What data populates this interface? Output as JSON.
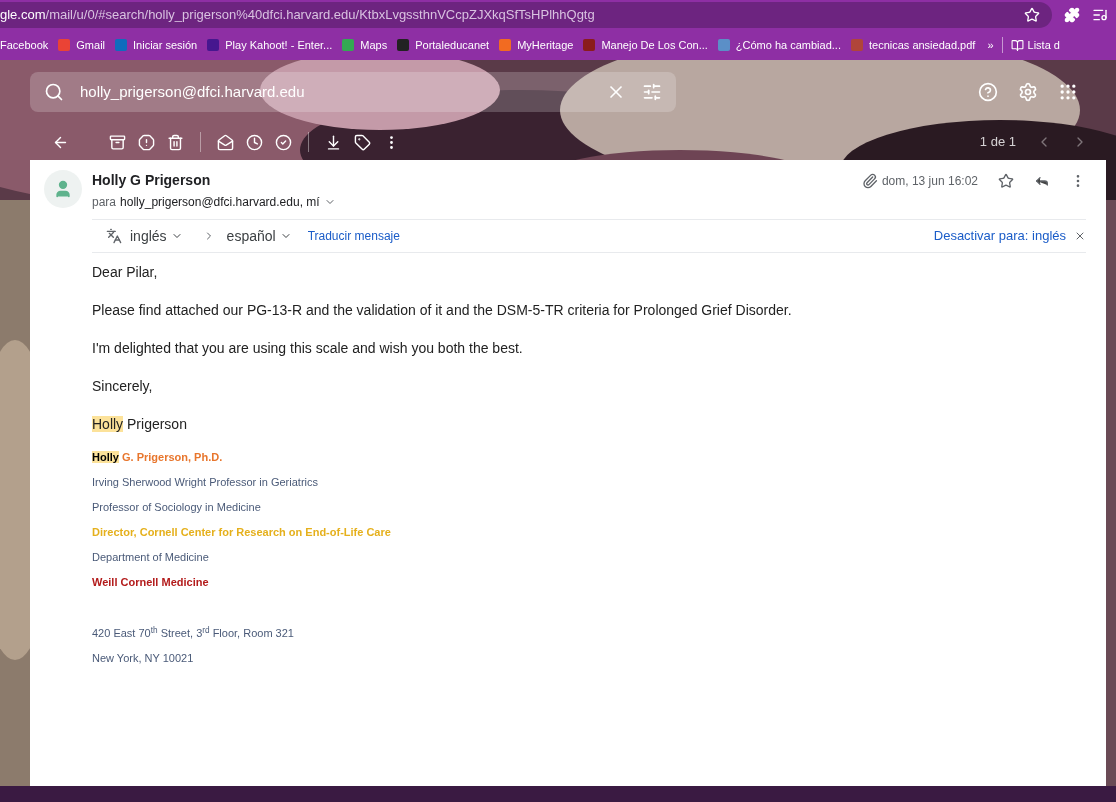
{
  "browser": {
    "url_host": "gle.com",
    "url_path": "/mail/u/0/#search/holly_prigerson%40dfci.harvard.edu/KtbxLvgssthnVCcpZJXkqSfTsHPlhhQgtg"
  },
  "bookmarks": [
    {
      "label": "Facebook"
    },
    {
      "label": "Gmail",
      "color": "#ea4335"
    },
    {
      "label": "Iniciar sesión",
      "color": "#0f6cbd"
    },
    {
      "label": "Play Kahoot! - Enter...",
      "color": "#46178f"
    },
    {
      "label": "Maps",
      "color": "#34a853"
    },
    {
      "label": "Portaleducanet",
      "color": "#222222"
    },
    {
      "label": "MyHeritage",
      "color": "#f26b21"
    },
    {
      "label": "Manejo De Los Con...",
      "color": "#8a1c1c"
    },
    {
      "label": "¿Cómo ha cambiad...",
      "color": "#5b8fc7"
    },
    {
      "label": "tecnicas ansiedad.pdf",
      "color": "#b0453a"
    }
  ],
  "bookmarks_overflow": "»",
  "reading_list": "Lista d",
  "search": {
    "value": "holly_prigerson@dfci.harvard.edu"
  },
  "pager": "1 de 1",
  "message": {
    "sender": "Holly G Prigerson",
    "to_prefix": "para",
    "to": "holly_prigerson@dfci.harvard.edu, mí",
    "date": "dom, 13 jun 16:02",
    "translate": {
      "from": "inglés",
      "to": "español",
      "action": "Traducir mensaje",
      "disable": "Desactivar para: inglés"
    },
    "body": [
      "Dear Pilar,",
      "Please find attached our PG-13-R and the validation of it and the DSM-5-TR criteria for Prolonged Grief Disorder.",
      "I'm delighted that you are using this scale and wish you both the best.",
      "Sincerely,"
    ],
    "signoff": [
      {
        "text": "Holly",
        "highlighted": true
      },
      {
        "text": " Prigerson",
        "highlighted": false
      }
    ],
    "signature": [
      {
        "kind": "line",
        "bold": true,
        "color": "#e8762d",
        "parts": [
          {
            "text": "Holly",
            "highlighted": true
          },
          {
            "text": " G. Prigerson, Ph.D.",
            "highlighted": false
          }
        ]
      },
      {
        "kind": "line",
        "bold": false,
        "color": "#4a5a78",
        "parts": [
          {
            "text": "Irving Sherwood Wright Professor in Geriatrics",
            "highlighted": false
          }
        ]
      },
      {
        "kind": "line",
        "bold": false,
        "color": "#4a5a78",
        "parts": [
          {
            "text": "Professor of Sociology in Medicine",
            "highlighted": false
          }
        ]
      },
      {
        "kind": "line",
        "bold": true,
        "color": "#e5b01c",
        "parts": [
          {
            "text": "Director, Cornell Center for Research on End-of-Life Care",
            "highlighted": false
          }
        ]
      },
      {
        "kind": "line",
        "bold": false,
        "color": "#4a5a78",
        "parts": [
          {
            "text": "Department of Medicine",
            "highlighted": false
          }
        ]
      },
      {
        "kind": "line",
        "bold": true,
        "color": "#b31b1b",
        "parts": [
          {
            "text": "Weill Cornell Medicine",
            "highlighted": false
          }
        ]
      },
      {
        "kind": "address",
        "bold": false,
        "color": "#4a5a78",
        "parts": [
          {
            "text": "420 East 70$^{th}$ Street, 3$^{rd}$ Floor, Room 321",
            "highlighted": false
          }
        ]
      },
      {
        "kind": "line",
        "bold": false,
        "color": "#4a5a78",
        "parts": [
          {
            "text": "New York, NY 10021",
            "highlighted": false
          }
        ]
      }
    ]
  }
}
